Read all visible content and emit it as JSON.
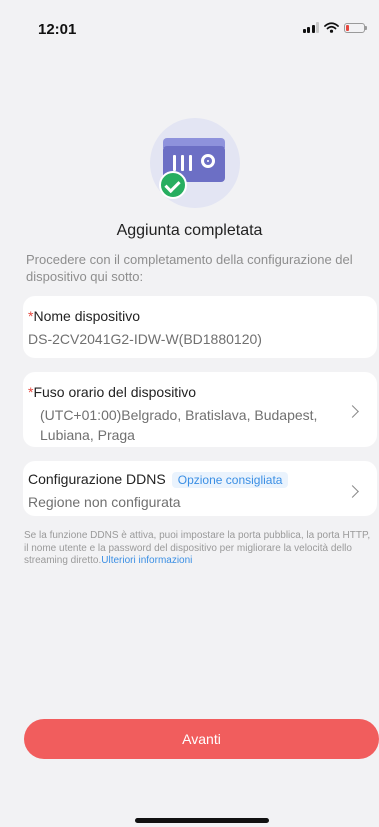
{
  "status_bar": {
    "time": "12:01",
    "battery_level": 0.15,
    "battery_color": "#e5483f"
  },
  "header": {
    "title": "Aggiunta completata"
  },
  "instructions": "Procedere con il completamento della configurazione del dispositivo qui sotto:",
  "device_name": {
    "required_mark": "*",
    "label": "Nome dispositivo",
    "value": "DS-2CV2041G2-IDW-W(BD1880120)"
  },
  "timezone": {
    "required_mark": "*",
    "label": "Fuso orario del dispositivo",
    "value": "(UTC+01:00)Belgrado, Bratislava, Budapest, Lubiana, Praga"
  },
  "ddns": {
    "label": "Configurazione DDNS",
    "tag": "Opzione consigliata",
    "value": "Regione non configurata"
  },
  "footnote": {
    "text": "Se la funzione DDNS è attiva, puoi impostare la porta pubblica, la porta HTTP, il nome utente e la password del dispositivo per migliorare la velocità dello streaming diretto.",
    "link": "Ulteriori informazioni"
  },
  "next_button": "Avanti",
  "colors": {
    "accent": "#f15d5d",
    "link": "#3b8fe4",
    "success": "#27ae60",
    "device": "#6c6fc5"
  }
}
